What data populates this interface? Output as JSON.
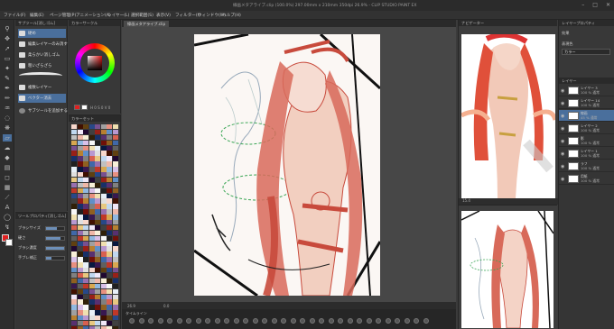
{
  "title": "線画メタアライブ.clip (100.0%) 297.00mm x 210mm 350dpi 26.9% - CLIP STUDIO PAINT EX",
  "menu": [
    "ファイル(F)",
    "編集(E)",
    "ページ管理(P)",
    "アニメーション(A)",
    "レイヤー(L)",
    "選択範囲(S)",
    "表示(V)",
    "フィルター(I)",
    "ウィンドウ(W)",
    "ヘルプ(H)"
  ],
  "subtool": {
    "header": "サブツール[消しゴム]",
    "items": [
      "硬め",
      "編集レイヤーのみ消す",
      "柔らかい消しゴム",
      "粗いざらざら",
      "複数レイヤー",
      "ベクター消去"
    ],
    "add_label": "サブツールを追加する"
  },
  "toolprop": {
    "header": "ツールプロパティ[消しゴム]",
    "rows": [
      {
        "label": "ブラシサイズ",
        "value": 0.6
      },
      {
        "label": "硬さ",
        "value": 0.8
      },
      {
        "label": "ブラシ濃度",
        "value": 1.0
      },
      {
        "label": "手ブレ補正",
        "value": 0.3
      }
    ]
  },
  "color_panel": {
    "header": "カラーサークル",
    "numbers": "H 0 S 0 V 0"
  },
  "palette": {
    "header": "カラーセット"
  },
  "canvas": {
    "tab": "線画メタアライブ.clip",
    "zoom": "26.9",
    "angle": "0.0"
  },
  "timeline": {
    "header": "タイムライン"
  },
  "navigator": {
    "header": "ナビゲーター",
    "zoom": "15.4"
  },
  "subview": {
    "header": "サブビュー"
  },
  "layer_prop": {
    "header": "レイヤープロパティ",
    "effect": "効果",
    "expression": "表現色",
    "expression_value": "カラー"
  },
  "layers": {
    "header": "レイヤー",
    "rows": [
      {
        "name": "レイヤー 3",
        "mode": "100 % 通常"
      },
      {
        "name": "レイヤー 14",
        "mode": "100 % 通常"
      },
      {
        "name": "線画",
        "mode": "45 % 通常"
      },
      {
        "name": "レイヤー 2",
        "mode": "100 % 通常"
      },
      {
        "name": "影",
        "mode": "100 % 通常"
      },
      {
        "name": "レイヤー 1",
        "mode": "100 % 通常"
      },
      {
        "name": "ラフ",
        "mode": "100 % 通常"
      },
      {
        "name": "用紙",
        "mode": "100 % 通常"
      }
    ]
  },
  "colors": {
    "accent": "#4a6f9c",
    "main_color": "#e02020",
    "line_red": "#c84a3c",
    "green_rough": "#3aa655",
    "skin": "#f2cfc0"
  }
}
